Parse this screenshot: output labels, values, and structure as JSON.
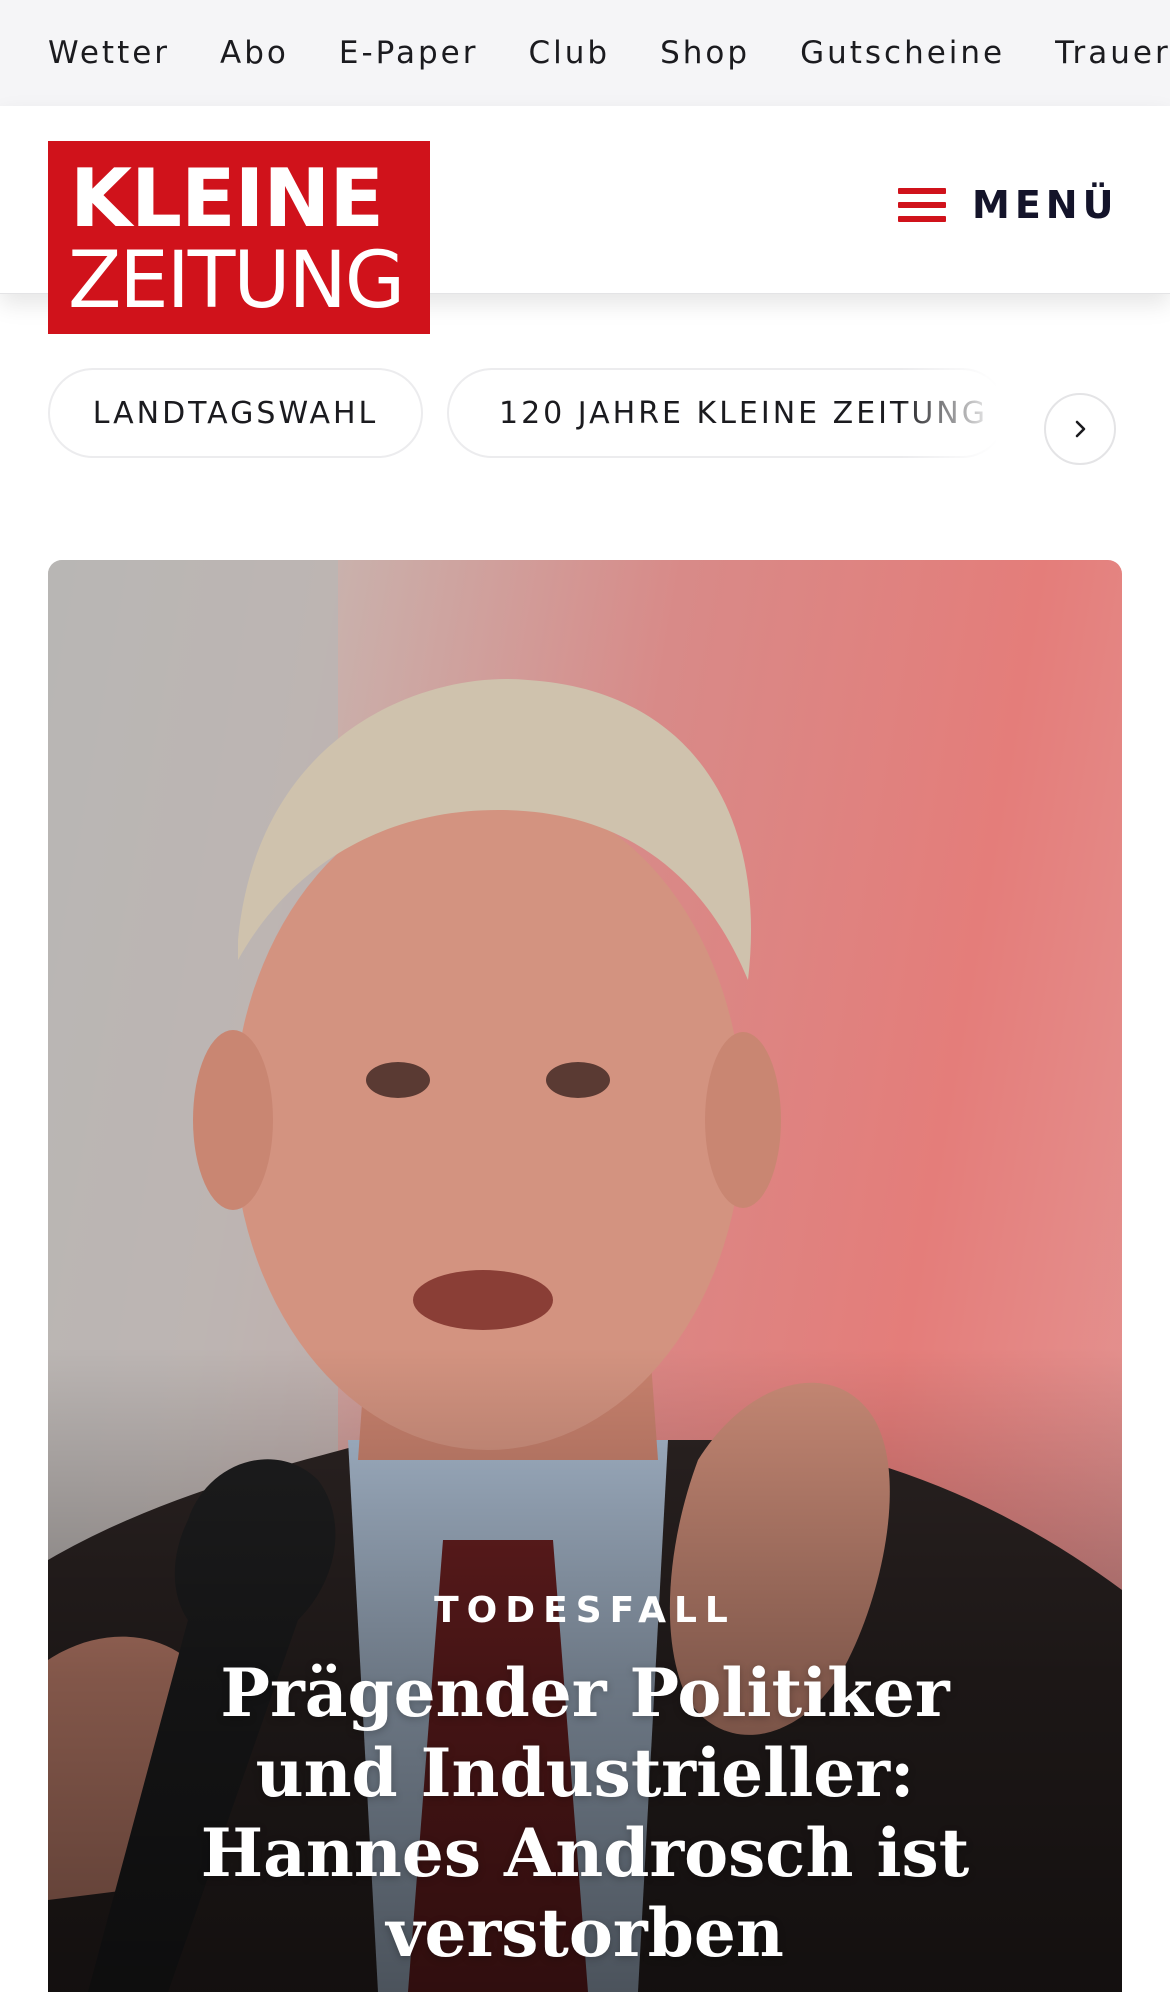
{
  "service_nav": {
    "items": [
      {
        "label": "Wetter"
      },
      {
        "label": "Abo"
      },
      {
        "label": "E-Paper"
      },
      {
        "label": "Club"
      },
      {
        "label": "Shop"
      },
      {
        "label": "Gutscheine"
      },
      {
        "label": "Trauerp"
      }
    ]
  },
  "header": {
    "logo": {
      "line1": "KLEINE",
      "line2": "ZEITUNG"
    },
    "menu_label": "MENÜ",
    "brand_color": "#d0121b"
  },
  "topics": {
    "chips": [
      {
        "label": "LANDTAGSWAHL"
      },
      {
        "label": "120 JAHRE KLEINE ZEITUNG"
      }
    ],
    "next_icon": "chevron-right-icon"
  },
  "hero": {
    "kicker": "TODESFALL",
    "headline": "Prägender Politiker und Industrieller: Hannes Androsch ist verstorben"
  }
}
